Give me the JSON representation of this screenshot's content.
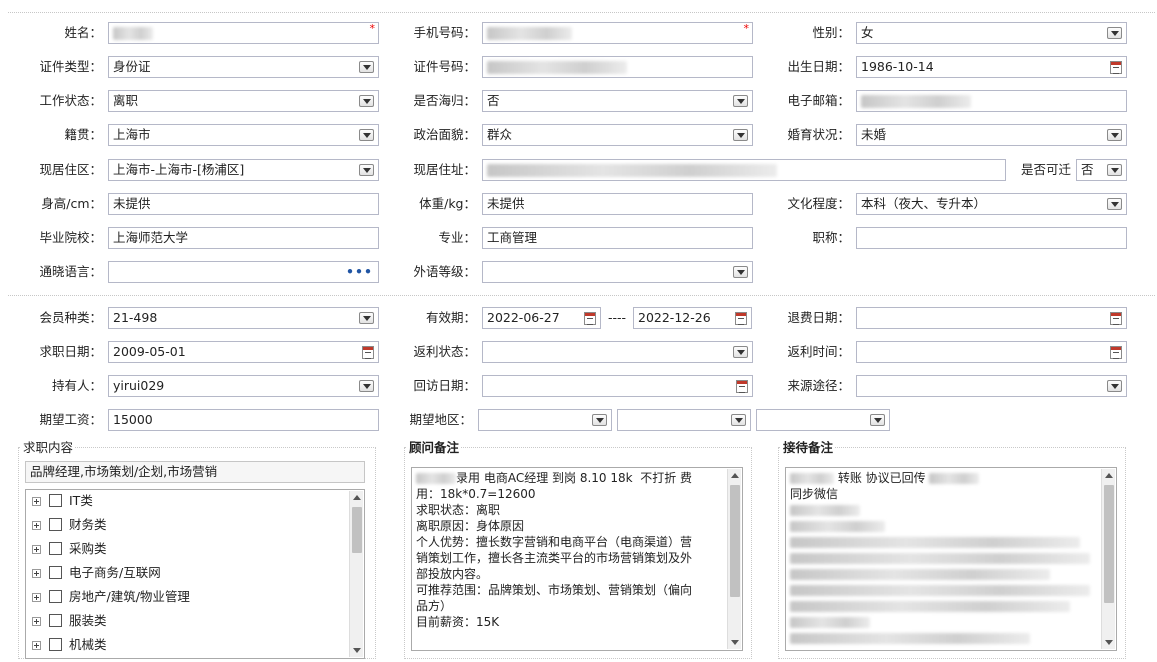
{
  "section1": {
    "name": {
      "label": "姓名："
    },
    "phone": {
      "label": "手机号码："
    },
    "gender": {
      "label": "性别：",
      "value": "女"
    },
    "id_type": {
      "label": "证件类型：",
      "value": "身份证"
    },
    "id_number": {
      "label": "证件号码："
    },
    "birth_date": {
      "label": "出生日期：",
      "value": "1986-10-14"
    },
    "work_status": {
      "label": "工作状态：",
      "value": "离职"
    },
    "overseas": {
      "label": "是否海归：",
      "value": "否"
    },
    "email": {
      "label": "电子邮箱："
    },
    "native_place": {
      "label": "籍贯：",
      "value": "上海市"
    },
    "political": {
      "label": "政治面貌：",
      "value": "群众"
    },
    "marital": {
      "label": "婚育状况：",
      "value": "未婚"
    },
    "residence_area": {
      "label": "现居住区：",
      "value": "上海市-上海市-[杨浦区]"
    },
    "residence_addr": {
      "label": "现居住址："
    },
    "relocate": {
      "label": "是否可迁",
      "value": "否"
    },
    "height": {
      "label": "身高/cm：",
      "value": "未提供"
    },
    "weight": {
      "label": "体重/kg：",
      "value": "未提供"
    },
    "education": {
      "label": "文化程度：",
      "value": "本科（夜大、专升本）"
    },
    "school": {
      "label": "毕业院校：",
      "value": "上海师范大学"
    },
    "major": {
      "label": "专业：",
      "value": "工商管理"
    },
    "title": {
      "label": "职称：",
      "value": ""
    },
    "languages": {
      "label": "通晓语言：",
      "value": "",
      "button": "•••"
    },
    "foreign_level": {
      "label": "外语等级：",
      "value": ""
    }
  },
  "section2": {
    "member_type": {
      "label": "会员种类：",
      "value": "21-498"
    },
    "valid_period": {
      "label": "有效期：",
      "start": "2022-06-27",
      "separator": "----",
      "end": "2022-12-26"
    },
    "refund_date": {
      "label": "退费日期：",
      "value": ""
    },
    "job_date": {
      "label": "求职日期：",
      "value": "2009-05-01"
    },
    "rebate_status": {
      "label": "返利状态：",
      "value": ""
    },
    "rebate_time": {
      "label": "返利时间：",
      "value": ""
    },
    "holder": {
      "label": "持有人：",
      "value": "yirui029"
    },
    "visit_date": {
      "label": "回访日期：",
      "value": ""
    },
    "source": {
      "label": "来源途径：",
      "value": ""
    },
    "expected_salary": {
      "label": "期望工资：",
      "value": "15000"
    },
    "expected_region": {
      "label": "期望地区：",
      "values": [
        "",
        "",
        ""
      ]
    }
  },
  "job_panel": {
    "title": "求职内容",
    "summary": "品牌经理,市场策划/企划,市场营销",
    "categories": [
      "IT类",
      "财务类",
      "采购类",
      "电子商务/互联网",
      "房地产/建筑/物业管理",
      "服装类",
      "机械类"
    ]
  },
  "advisor_panel": {
    "title": "顾问备注",
    "lines": [
      "录用 电商AC经理 到岗 8.10 18k  不打折 费",
      "用：18k*0.7=12600",
      "",
      "求职状态：离职",
      "离职原因：身体原因",
      "个人优势：擅长数字营销和电商平台（电商渠道）营",
      "销策划工作，擅长各主流类平台的市场营销策划及外",
      "部投放内容。",
      "可推荐范围：品牌策划、市场策划、营销策划（偏向",
      "品方）",
      "目前薪资：15K"
    ]
  },
  "reception_panel": {
    "title": "接待备注",
    "line1": "转账 协议已回传",
    "line2": "同步微信"
  }
}
